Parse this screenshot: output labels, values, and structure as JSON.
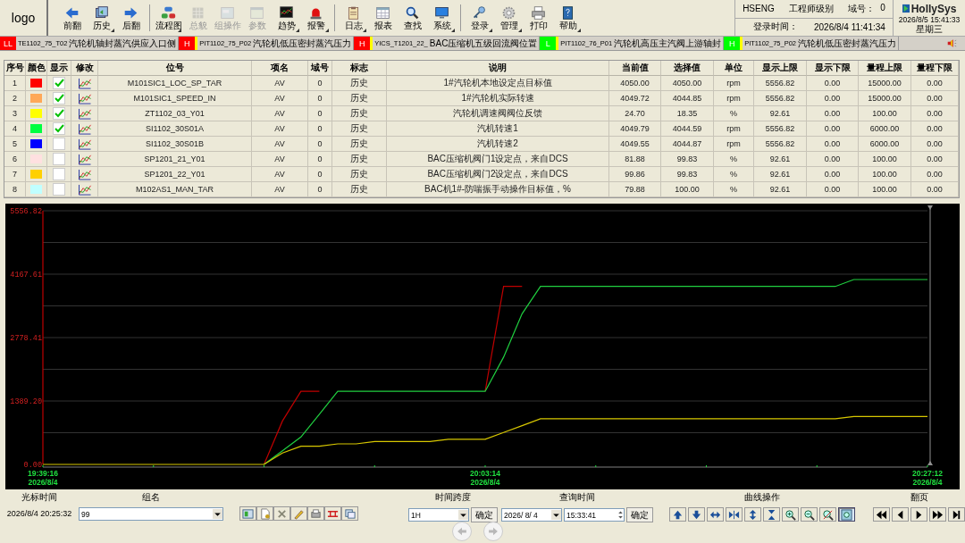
{
  "logo": "logo",
  "toolbar": [
    {
      "label": "前翻",
      "disabled": false,
      "dropdown": false
    },
    {
      "label": "历史",
      "disabled": false,
      "dropdown": true
    },
    {
      "label": "后翻",
      "disabled": false,
      "dropdown": false
    },
    {
      "label": "流程图",
      "disabled": false,
      "dropdown": true
    },
    {
      "label": "总貌",
      "disabled": true,
      "dropdown": false
    },
    {
      "label": "组操作",
      "disabled": true,
      "dropdown": false
    },
    {
      "label": "参数",
      "disabled": true,
      "dropdown": false
    },
    {
      "label": "趋势",
      "disabled": false,
      "dropdown": true
    },
    {
      "label": "报警",
      "disabled": false,
      "dropdown": true
    },
    {
      "label": "日志",
      "disabled": false,
      "dropdown": true
    },
    {
      "label": "报表",
      "disabled": false,
      "dropdown": false
    },
    {
      "label": "查找",
      "disabled": false,
      "dropdown": false
    },
    {
      "label": "系统",
      "disabled": false,
      "dropdown": true
    },
    {
      "label": "登录",
      "disabled": false,
      "dropdown": true
    },
    {
      "label": "管理",
      "disabled": false,
      "dropdown": true
    },
    {
      "label": "打印",
      "disabled": false,
      "dropdown": false
    },
    {
      "label": "帮助",
      "disabled": false,
      "dropdown": true
    }
  ],
  "user": {
    "name": "HSENG",
    "level": "工程师级别",
    "domain_label": "域号：",
    "domain": "0",
    "login_label": "登录时间：",
    "login_time": "2026/8/4 11:41:34"
  },
  "brand": {
    "name": "HollySys",
    "datetime": "2026/8/5 15:41:33",
    "weekday": "星期三"
  },
  "alarms": [
    {
      "level": "LL",
      "color": "#ff0000",
      "tag": "TE1102_75_T02",
      "description": "汽轮机轴封蒸汽供应入口侧"
    },
    {
      "level": "H",
      "color": "#ff0000",
      "tag": "PIT1102_75_P02",
      "description": "汽轮机低压密封蒸汽压力"
    },
    {
      "level": "H",
      "color": "#ff0000",
      "tag": "YICS_T1201_22_",
      "description": "BAC压缩机五级回流阀位置"
    },
    {
      "level": "L",
      "color": "#00ff00",
      "tag": "PIT1102_76_P01",
      "description": "汽轮机高压主汽阀上游轴封"
    },
    {
      "level": "H",
      "color": "#00ff00",
      "tag": "PIT1102_75_P02",
      "description": "汽轮机低压密封蒸汽压力"
    }
  ],
  "table": {
    "columns": [
      "序号",
      "颜色",
      "显示",
      "修改",
      "位号",
      "项名",
      "域号",
      "标志",
      "说明",
      "当前值",
      "选择值",
      "单位",
      "显示上限",
      "显示下限",
      "量程上限",
      "量程下限"
    ],
    "rows": [
      {
        "index": "1",
        "color": "#ff0000",
        "shown": true,
        "tag": "M101SIC1_LOC_SP_TAR",
        "item": "AV",
        "domain": "0",
        "flag": "历史",
        "description": "1#汽轮机本地设定点目标值",
        "current": "4050.00",
        "selected_value": "4050.00",
        "unit": "rpm",
        "display_max": "5556.82",
        "display_min": "0.00",
        "range_max": "15000.00",
        "range_min": "0.00"
      },
      {
        "index": "2",
        "color": "#ffa858",
        "shown": true,
        "tag": "M101SIC1_SPEED_IN",
        "item": "AV",
        "domain": "0",
        "flag": "历史",
        "description": "1#汽轮机实际转速",
        "current": "4049.72",
        "selected_value": "4044.85",
        "unit": "rpm",
        "display_max": "5556.82",
        "display_min": "0.00",
        "range_max": "15000.00",
        "range_min": "0.00"
      },
      {
        "index": "3",
        "color": "#ffff00",
        "shown": true,
        "tag": "ZT1102_03_Y01",
        "item": "AV",
        "domain": "0",
        "flag": "历史",
        "description": "汽轮机调速阀阀位反馈",
        "current": "24.70",
        "selected_value": "18.35",
        "unit": "%",
        "display_max": "92.61",
        "display_min": "0.00",
        "range_max": "100.00",
        "range_min": "0.00"
      },
      {
        "index": "4",
        "color": "#00ff40",
        "shown": true,
        "tag": "SI1102_30S01A",
        "item": "AV",
        "domain": "0",
        "flag": "历史",
        "description": "汽机转速1",
        "current": "4049.79",
        "selected_value": "4044.59",
        "unit": "rpm",
        "display_max": "5556.82",
        "display_min": "0.00",
        "range_max": "6000.00",
        "range_min": "0.00"
      },
      {
        "index": "5",
        "color": "#0000ff",
        "shown": false,
        "tag": "SI1102_30S01B",
        "item": "AV",
        "domain": "0",
        "flag": "历史",
        "description": "汽机转速2",
        "current": "4049.55",
        "selected_value": "4044.87",
        "unit": "rpm",
        "display_max": "5556.82",
        "display_min": "0.00",
        "range_max": "6000.00",
        "range_min": "0.00"
      },
      {
        "index": "6",
        "color": "#ffe0e0",
        "shown": false,
        "tag": "SP1201_21_Y01",
        "item": "AV",
        "domain": "0",
        "flag": "历史",
        "description": "BAC压缩机阀门1设定点，来自DCS",
        "current": "81.88",
        "selected_value": "99.83",
        "unit": "%",
        "display_max": "92.61",
        "display_min": "0.00",
        "range_max": "100.00",
        "range_min": "0.00"
      },
      {
        "index": "7",
        "color": "#ffd000",
        "shown": false,
        "tag": "SP1201_22_Y01",
        "item": "AV",
        "domain": "0",
        "flag": "历史",
        "description": "BAC压缩机阀门2设定点，来自DCS",
        "current": "99.86",
        "selected_value": "99.83",
        "unit": "%",
        "display_max": "92.61",
        "display_min": "0.00",
        "range_max": "100.00",
        "range_min": "0.00"
      },
      {
        "index": "8",
        "color": "#c0ffff",
        "shown": false,
        "tag": "M102AS1_MAN_TAR",
        "item": "AV",
        "domain": "0",
        "flag": "历史",
        "description": "BAC机1#-防喘振手动操作目标值，%",
        "current": "79.88",
        "selected_value": "100.00",
        "unit": "%",
        "display_max": "92.61",
        "display_min": "0.00",
        "range_max": "100.00",
        "range_min": "0.00"
      }
    ]
  },
  "trend": {
    "chart_data": {
      "type": "line",
      "categories": [
        "19:39:16 2026/8/4",
        null,
        null,
        null,
        null,
        null,
        null,
        null,
        null,
        null,
        null,
        null,
        null,
        null,
        null,
        null,
        null,
        null,
        null,
        null,
        null,
        null,
        null,
        null,
        "20:03:14 2026/8/4",
        null,
        null,
        null,
        null,
        null,
        null,
        null,
        null,
        null,
        null,
        null,
        null,
        null,
        null,
        null,
        null,
        null,
        null,
        null,
        null,
        null,
        null,
        null,
        "20:27:12 2026/8/4"
      ],
      "ylim": [
        0,
        5556.82
      ],
      "grid": true,
      "yticks": [
        {
          "value": 0,
          "label": "0.00"
        },
        {
          "value": 1389.2,
          "label": "1389.20"
        },
        {
          "value": 2778.41,
          "label": "2778.41"
        },
        {
          "value": 4167.61,
          "label": "4167.61"
        },
        {
          "value": 5556.82,
          "label": "5556.82"
        }
      ],
      "series": [
        {
          "color": "#c00000",
          "values": [
            null,
            null,
            null,
            null,
            null,
            null,
            null,
            null,
            null,
            null,
            null,
            null,
            0,
            950,
            1600,
            1600,
            null,
            null,
            null,
            null,
            null,
            null,
            null,
            null,
            1600,
            3900,
            3900,
            null,
            null,
            null,
            null,
            null,
            null,
            null,
            null,
            null,
            null,
            null,
            null,
            null,
            null,
            null,
            null,
            null,
            null,
            null,
            null,
            null,
            null
          ]
        },
        {
          "color": "#20d040",
          "values": [
            null,
            null,
            null,
            null,
            null,
            null,
            null,
            null,
            null,
            null,
            null,
            null,
            0,
            300,
            600,
            1100,
            1600,
            1600,
            1600,
            1600,
            1600,
            1600,
            1600,
            1600,
            1600,
            2350,
            3300,
            3900,
            3900,
            3900,
            3900,
            3900,
            3900,
            3900,
            3900,
            3900,
            3900,
            3900,
            3900,
            3900,
            3900,
            3900,
            3900,
            3900,
            4050,
            4050,
            4050,
            4050,
            4050
          ]
        },
        {
          "color": "#d8c800",
          "values": [
            0,
            0,
            0,
            0,
            0,
            0,
            0,
            0,
            0,
            0,
            0,
            0,
            0,
            250,
            400,
            400,
            450,
            450,
            500,
            500,
            500,
            500,
            550,
            550,
            550,
            700,
            850,
            1000,
            1000,
            1000,
            1000,
            1000,
            1000,
            1000,
            1000,
            1000,
            1000,
            1000,
            1000,
            1000,
            1000,
            1000,
            1000,
            1000,
            1050,
            1050,
            1050,
            1050,
            1050
          ]
        }
      ]
    }
  },
  "bottom": {
    "cursor_label": "光标时间",
    "cursor_time": "2026/8/4 20:25:32",
    "group_label": "组名",
    "group_value": "99",
    "span_label": "时间跨度",
    "span_value": "1H",
    "span_ok": "确定",
    "query_label": "查询时间",
    "query_date": "2026/ 8/ 4",
    "query_time": "15:33:41",
    "query_ok": "确定",
    "curve_label": "曲线操作",
    "curve_ops": [
      {
        "selected": false
      },
      {
        "selected": false
      },
      {
        "selected": false
      },
      {
        "selected": false
      },
      {
        "selected": false
      },
      {
        "selected": false
      },
      {
        "selected": false
      },
      {
        "selected": false
      },
      {
        "selected": false
      },
      {
        "selected": true
      }
    ],
    "page_label": "翻页"
  }
}
